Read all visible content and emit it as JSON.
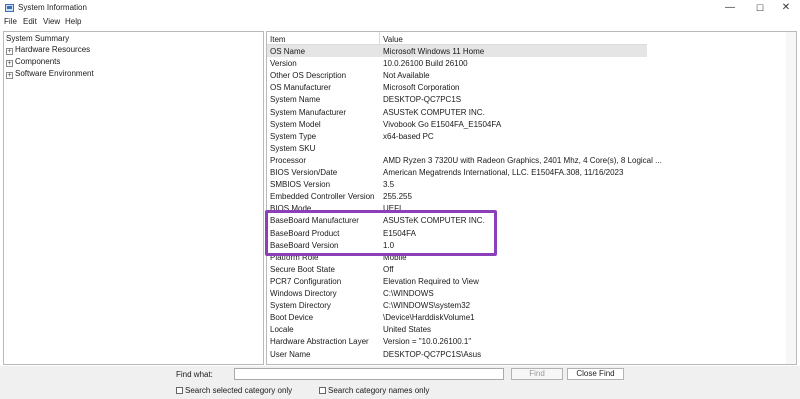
{
  "window": {
    "title": "System Information",
    "minimize": "—",
    "maximize": "☐",
    "close": "✕"
  },
  "menu": [
    "File",
    "Edit",
    "View",
    "Help"
  ],
  "tree": {
    "root": "System Summary",
    "nodes": [
      "Hardware Resources",
      "Components",
      "Software Environment"
    ],
    "expander": "+"
  },
  "details": {
    "headers": {
      "item": "Item",
      "value": "Value"
    },
    "rows": [
      {
        "item": "OS Name",
        "value": "Microsoft Windows 11 Home"
      },
      {
        "item": "Version",
        "value": "10.0.26100 Build 26100"
      },
      {
        "item": "Other OS Description",
        "value": "Not Available"
      },
      {
        "item": "OS Manufacturer",
        "value": "Microsoft Corporation"
      },
      {
        "item": "System Name",
        "value": "DESKTOP-QC7PC1S"
      },
      {
        "item": "System Manufacturer",
        "value": "ASUSTeK COMPUTER INC."
      },
      {
        "item": "System Model",
        "value": "Vivobook Go E1504FA_E1504FA"
      },
      {
        "item": "System Type",
        "value": "x64-based PC"
      },
      {
        "item": "System SKU",
        "value": ""
      },
      {
        "item": "Processor",
        "value": "AMD Ryzen 3 7320U with Radeon Graphics, 2401 Mhz, 4 Core(s), 8 Logical ..."
      },
      {
        "item": "BIOS Version/Date",
        "value": "American Megatrends International, LLC. E1504FA.308, 11/16/2023"
      },
      {
        "item": "SMBIOS Version",
        "value": "3.5"
      },
      {
        "item": "Embedded Controller Version",
        "value": "255.255"
      },
      {
        "item": "BIOS Mode",
        "value": "UEFI"
      },
      {
        "item": "BaseBoard Manufacturer",
        "value": "ASUSTeK COMPUTER INC."
      },
      {
        "item": "BaseBoard Product",
        "value": "E1504FA"
      },
      {
        "item": "BaseBoard Version",
        "value": "1.0"
      },
      {
        "item": "Platform Role",
        "value": "Mobile"
      },
      {
        "item": "Secure Boot State",
        "value": "Off"
      },
      {
        "item": "PCR7 Configuration",
        "value": "Elevation Required to View"
      },
      {
        "item": "Windows Directory",
        "value": "C:\\WINDOWS"
      },
      {
        "item": "System Directory",
        "value": "C:\\WINDOWS\\system32"
      },
      {
        "item": "Boot Device",
        "value": "\\Device\\HarddiskVolume1"
      },
      {
        "item": "Locale",
        "value": "United States"
      },
      {
        "item": "Hardware Abstraction Layer",
        "value": "Version = \"10.0.26100.1\""
      },
      {
        "item": "User Name",
        "value": "DESKTOP-QC7PC1S\\Asus"
      }
    ]
  },
  "find": {
    "label": "Find what:",
    "value": "",
    "find_button": "Find",
    "close_find_button": "Close Find",
    "check_selected": "Search selected category only",
    "check_names": "Search category names only"
  },
  "colors": {
    "highlight": "#8b3fb8",
    "selected_row": "#e5e5e5"
  }
}
